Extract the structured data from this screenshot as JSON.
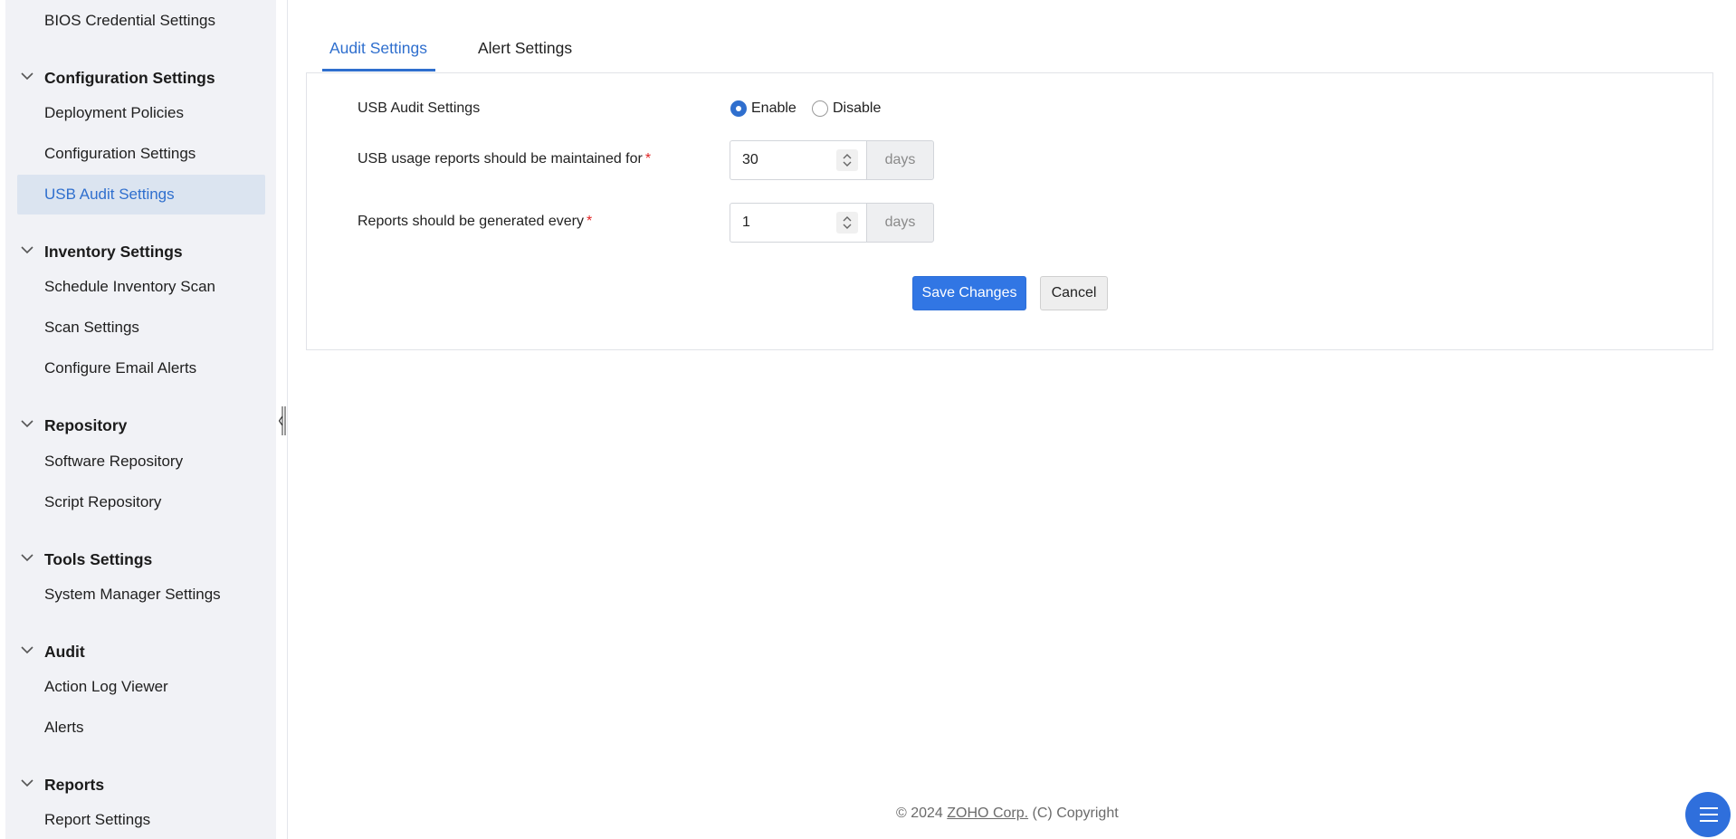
{
  "sidebar": {
    "top_item": "BIOS Credential Settings",
    "groups": [
      {
        "title": "Configuration Settings",
        "items": [
          "Deployment Policies",
          "Configuration Settings",
          "USB Audit Settings"
        ]
      },
      {
        "title": "Inventory Settings",
        "items": [
          "Schedule Inventory Scan",
          "Scan Settings",
          "Configure Email Alerts"
        ]
      },
      {
        "title": "Repository",
        "items": [
          "Software Repository",
          "Script Repository"
        ]
      },
      {
        "title": "Tools Settings",
        "items": [
          "System Manager Settings"
        ]
      },
      {
        "title": "Audit",
        "items": [
          "Action Log Viewer",
          "Alerts"
        ]
      },
      {
        "title": "Reports",
        "items": [
          "Report Settings"
        ]
      }
    ],
    "active_item": "USB Audit Settings"
  },
  "tabs": {
    "audit": "Audit Settings",
    "alert": "Alert Settings",
    "active": "Audit Settings"
  },
  "form": {
    "usb_audit_label": "USB Audit Settings",
    "enable_label": "Enable",
    "disable_label": "Disable",
    "selected": "Enable",
    "maintain_label": "USB usage reports should be maintained for",
    "maintain_value": "30",
    "generate_label": "Reports should be generated every",
    "generate_value": "1",
    "unit": "days",
    "required_mark": "*",
    "save_label": "Save Changes",
    "cancel_label": "Cancel"
  },
  "footer": {
    "prefix": "© 2024",
    "link": "ZOHO Corp.",
    "suffix": "(C) Copyright"
  },
  "colors": {
    "accent": "#2f6fce",
    "button": "#3176e4",
    "sidebar_bg": "#f1f2f6",
    "required": "#e02424"
  },
  "icons": [
    "chevron-down-icon",
    "collapse-sidebar-icon",
    "stepper-icon",
    "menu-icon"
  ]
}
